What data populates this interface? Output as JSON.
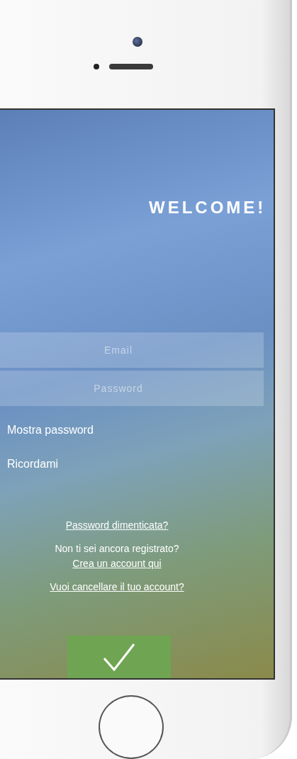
{
  "title": "WELCOME!",
  "fields": [
    {
      "placeholder": "Email"
    },
    {
      "placeholder": "Password"
    }
  ],
  "options": [
    "Mostra password",
    "Ricordami"
  ],
  "links": [
    {
      "kind": "link",
      "text": "Password dimenticata?"
    },
    {
      "kind": "text",
      "text": "Non ti sei ancora registrato?"
    },
    {
      "kind": "link",
      "text": "Crea un account qui"
    },
    {
      "kind": "link",
      "text": "Vuoi cancellare il tuo account?"
    }
  ]
}
